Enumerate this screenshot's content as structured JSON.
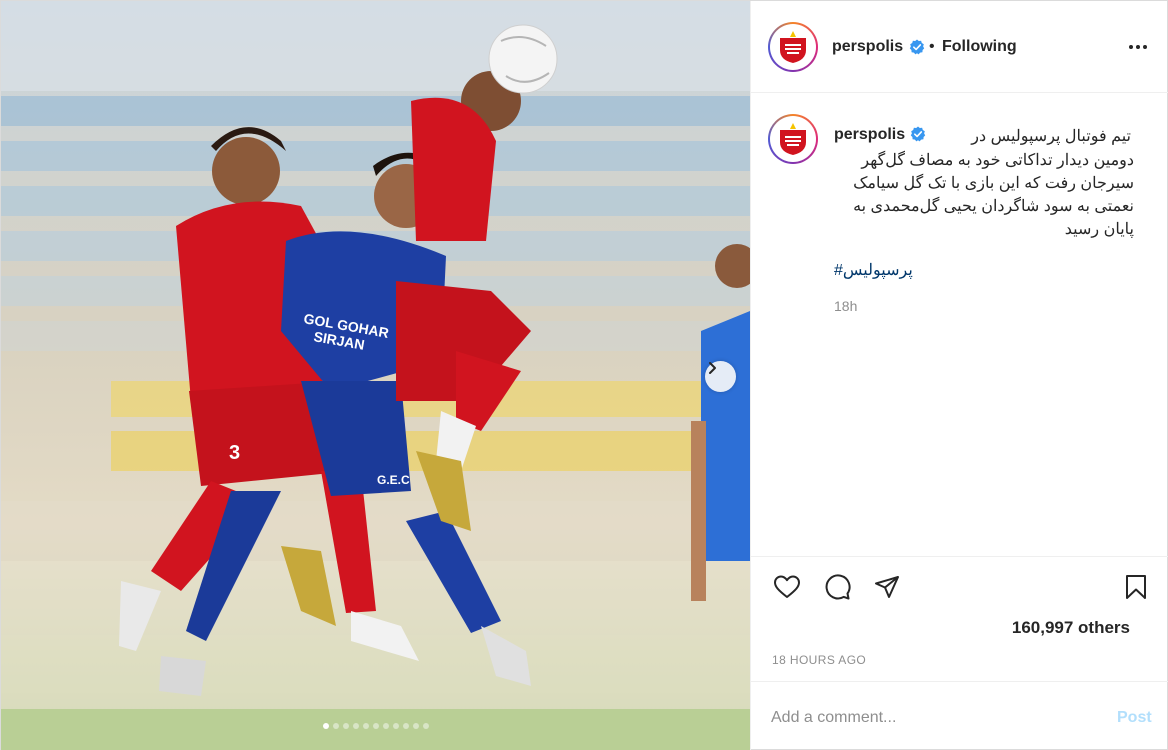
{
  "post": {
    "username": "perspolis",
    "separator": "•",
    "follow_status": "Following",
    "caption_line1": "تیم فوتبال پرسپولیس در",
    "caption_rest": "دومین دیدار تداکاتی خود به مصاف گل‌گهر سیرجان رفت که این بازی با تک گل سیامک نعمتی به سود شاگردان یحیی گل‌محمدی به پایان رسید",
    "hashtag": "#پرسپولیس",
    "time_ago": "18h",
    "likes": "160,997 others",
    "timestamp": "18 HOURS AGO",
    "comment_placeholder": "Add a comment...",
    "post_label": "Post",
    "carousel": {
      "total": 11,
      "active": 0
    }
  },
  "icons": {
    "more": "more-options-icon",
    "like": "heart-icon",
    "comment": "comment-icon",
    "share": "share-icon",
    "save": "bookmark-icon",
    "verified": "verified-badge-icon",
    "next": "chevron-right-icon"
  },
  "colors": {
    "accent": "#0095f6",
    "verified": "#3897f0",
    "post_disabled": "#b2dffc",
    "meta_gray": "#8e8e8e",
    "persepolis_red": "#d1141f",
    "opponent_blue": "#1e3fa3"
  }
}
